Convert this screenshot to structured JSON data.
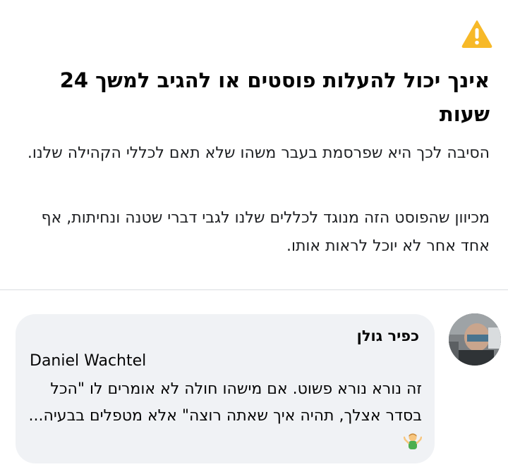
{
  "notice": {
    "icon": "warning-icon",
    "accent_color": "#f7b928",
    "title": "אינך יכול להעלות פוסטים או להגיב למשך 24 שעות",
    "paragraphs": [
      "הסיבה לכך היא שפרסמת בעבר משהו שלא תאם לכללי הקהילה שלנו.",
      "מכיוון שהפוסט הזה מנוגד לכללים שלנו לגבי דברי שטנה ונחיתות, אף אחד אחר לא יוכל לראות אותו."
    ]
  },
  "comment": {
    "author": "כפיר גולן",
    "mention": "Daniel Wachtel",
    "text": "זה נורא נורא פשוט. אם מישהו חולה לא אומרים לו \"הכל בסדר אצלך, תהיה איך שאתה רוצה\" אלא מטפלים בבעיה...",
    "emoji": "person-shrugging-emoji",
    "bubble_color": "#f0f2f5"
  }
}
